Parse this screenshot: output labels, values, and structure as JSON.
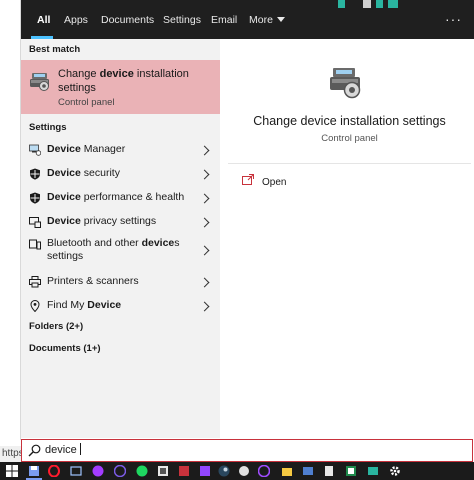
{
  "tabs": [
    {
      "label": "All",
      "active": true
    },
    {
      "label": "Apps"
    },
    {
      "label": "Documents"
    },
    {
      "label": "Settings"
    },
    {
      "label": "Email"
    },
    {
      "label": "More"
    }
  ],
  "options_label": "···",
  "best_match": {
    "section": "Best match",
    "title_pre": "Change ",
    "title_bold": "device",
    "title_post": " installation settings",
    "subtitle": "Control panel",
    "icon": "device-installation-icon"
  },
  "settings_section": "Settings",
  "settings": [
    {
      "bold": "Device",
      "rest": " Manager",
      "icon": "device-manager-icon"
    },
    {
      "bold": "Device",
      "rest": " security",
      "icon": "shield-icon"
    },
    {
      "bold": "Device",
      "rest": " performance & health",
      "icon": "shield-icon"
    },
    {
      "bold": "Device",
      "rest": " privacy settings",
      "icon": "privacy-icon"
    },
    {
      "pre": "Bluetooth and other ",
      "bold": "device",
      "rest": "s settings",
      "icon": "bluetooth-devices-icon"
    },
    {
      "pre": "Printers & scanners",
      "icon": "printer-icon"
    },
    {
      "pre": "Find My ",
      "bold": "Device",
      "icon": "find-device-icon"
    }
  ],
  "folders_label": "Folders (2+)",
  "documents_label": "Documents (1+)",
  "preview": {
    "title": "Change device installation settings",
    "subtitle": "Control panel",
    "open_label": "Open"
  },
  "search": {
    "value": "device"
  },
  "background_url_text": "https",
  "colors": {
    "accent": "#4cc2ff",
    "highlight": "#eab2b6",
    "search_border": "#c8323c",
    "topbar": "#1f1f1f",
    "taskbar": "#1b1b1b"
  }
}
